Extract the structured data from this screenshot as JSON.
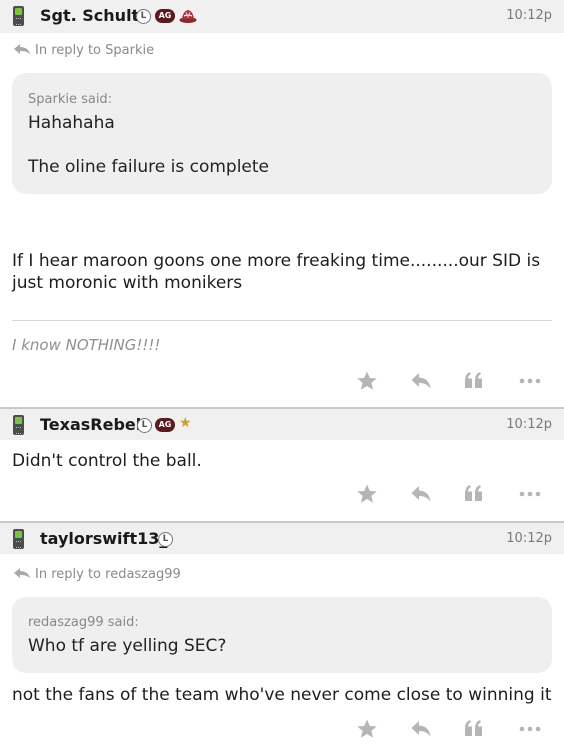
{
  "posts": [
    {
      "username": "Sgt. Schultz",
      "badges": {
        "l": "L",
        "ag": "AG"
      },
      "time": "10:12p",
      "in_reply_to": "In reply to Sparkie",
      "quote": {
        "author": "Sparkie said:",
        "lines": [
          "Hahahaha",
          "The oline failure is complete"
        ]
      },
      "body": "If I hear maroon goons one more freaking time.........our SID is just moronic with monikers",
      "signature": "I know NOTHING!!!!"
    },
    {
      "username": "TexasRebel",
      "badges": {
        "l": "L",
        "ag": "AG",
        "star": "★"
      },
      "time": "10:12p",
      "body": "Didn't control the ball."
    },
    {
      "username": "taylorswift13_",
      "badges": {
        "l": "L"
      },
      "time": "10:12p",
      "in_reply_to": "In reply to redaszag99",
      "quote": {
        "author": "redaszag99 said:",
        "lines": [
          "Who tf are yelling SEC?"
        ]
      },
      "body": "not the fans of the team who've never come close to winning it"
    }
  ],
  "action_icons": [
    "star-icon",
    "reply-icon",
    "quote-icon",
    "more-icon"
  ],
  "colors": {
    "header_bg": "#f0f0f0",
    "quote_bg": "#efefef",
    "ag_badge": "#5a1a1f",
    "phone_screen": "#7cc341",
    "icon_gray": "#b5b5b5"
  }
}
